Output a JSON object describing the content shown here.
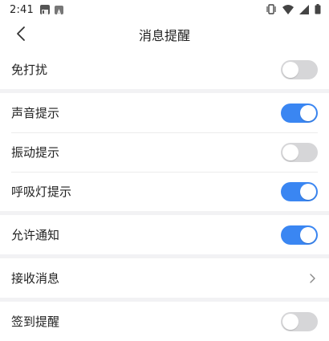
{
  "status_bar": {
    "time": "2:41",
    "left_icons": [
      "app-notification-icon",
      "a-badge-icon"
    ],
    "right_icons": [
      "vibrate-icon",
      "wifi-icon",
      "signal-icon",
      "battery-icon"
    ]
  },
  "header": {
    "back_icon": "chevron-left-icon",
    "title": "消息提醒"
  },
  "colors": {
    "accent": "#3a86f2",
    "toggle_off": "#d6d6d8",
    "background": "#f2f2f4"
  },
  "settings": {
    "do_not_disturb": {
      "label": "免打扰",
      "enabled": false
    },
    "sound": {
      "label": "声音提示",
      "enabled": true
    },
    "vibration": {
      "label": "振动提示",
      "enabled": false
    },
    "breathing_light": {
      "label": "呼吸灯提示",
      "enabled": true
    },
    "allow_notifications": {
      "label": "允许通知",
      "enabled": true
    },
    "receive_messages": {
      "label": "接收消息",
      "icon": "chevron-right-icon"
    },
    "checkin_reminder": {
      "label": "签到提醒",
      "enabled": false
    }
  }
}
